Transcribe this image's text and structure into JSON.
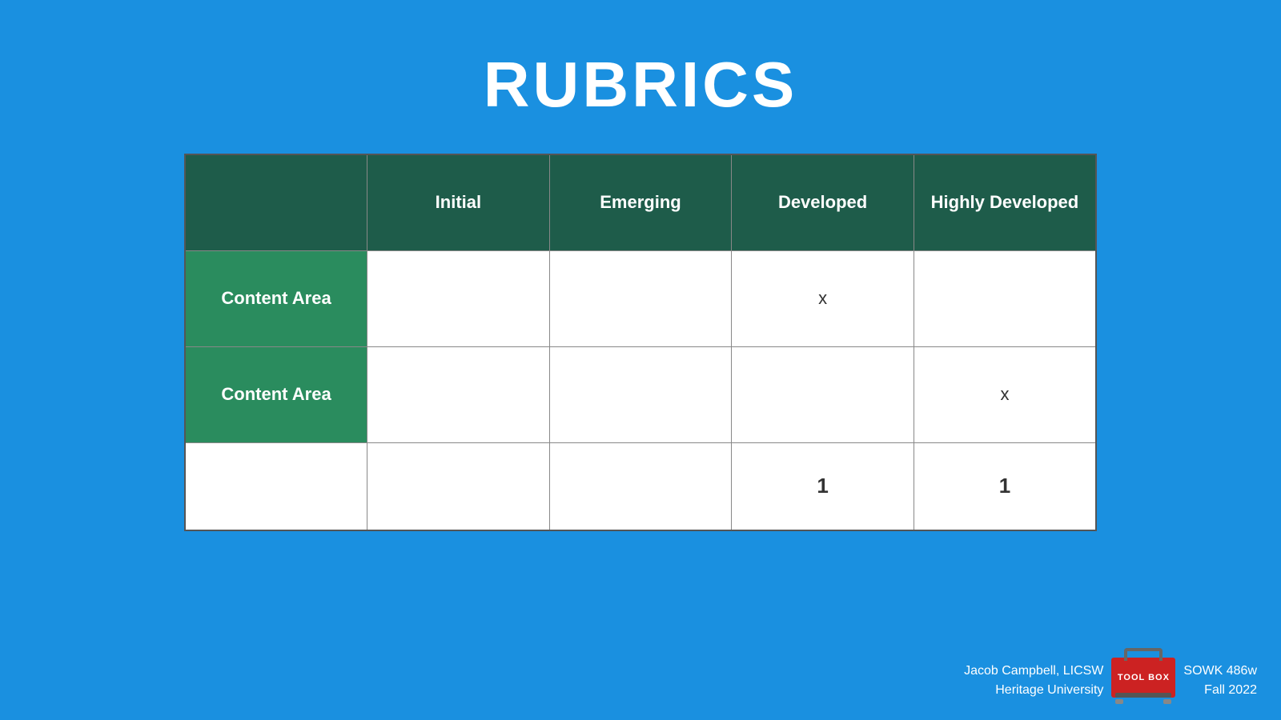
{
  "title": "RUBRICS",
  "table": {
    "headers": [
      "",
      "Initial",
      "Emerging",
      "Developed",
      "Highly Developed"
    ],
    "rows": [
      {
        "label": "Content Area",
        "cells": [
          "",
          "",
          "x",
          ""
        ]
      },
      {
        "label": "Content Area",
        "cells": [
          "",
          "",
          "",
          "x"
        ]
      },
      {
        "label": "",
        "cells": [
          "",
          "",
          "1",
          "1"
        ]
      }
    ]
  },
  "footer": {
    "author": "Jacob Campbell, LICSW",
    "institution": "Heritage University",
    "course": "SOWK 486w",
    "term": "Fall 2022",
    "toolbox_label": "TOOL BOX"
  }
}
